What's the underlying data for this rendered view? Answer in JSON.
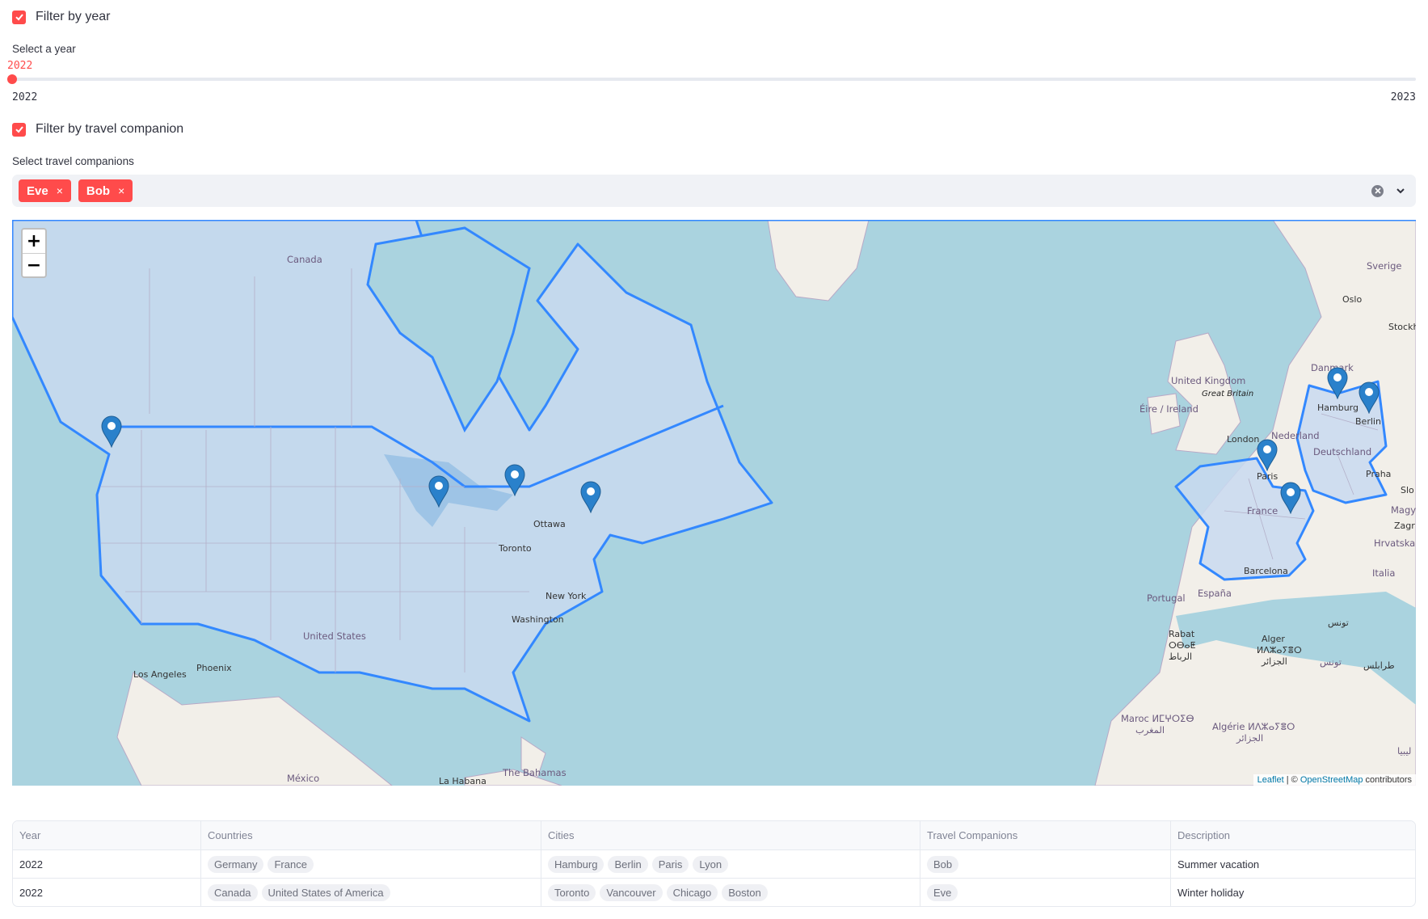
{
  "filters": {
    "year_checkbox": {
      "label": "Filter by year",
      "checked": true
    },
    "year_slider": {
      "label": "Select a year",
      "value": "2022",
      "min": "2022",
      "max": "2023",
      "position_fraction": 0.0
    },
    "companion_checkbox": {
      "label": "Filter by travel companion",
      "checked": true
    },
    "companion_select": {
      "label": "Select travel companions",
      "selected": [
        "Eve",
        "Bob"
      ],
      "remove_glyph": "×"
    }
  },
  "colors": {
    "accent": "#ff4b4b",
    "highlight_fill": "#c9d9f0",
    "highlight_stroke": "#3388ff",
    "water": "#aad3df",
    "land": "#f2efe9",
    "marker": "#2a81cb"
  },
  "map": {
    "zoom_in": "+",
    "zoom_out": "−",
    "attribution": {
      "leaflet": "Leaflet",
      "sep": " | © ",
      "osm": "OpenStreetMap",
      "suffix": " contributors"
    },
    "labels": {
      "canada": "Canada",
      "ottawa": "Ottawa",
      "toronto": "Toronto",
      "new_york": "New York",
      "washington": "Washington",
      "united_states": "United States",
      "phoenix": "Phoenix",
      "los_angeles": "Los Angeles",
      "mexico": "México",
      "la_habana": "La Habana",
      "bahamas": "The Bahamas",
      "sverige": "Sverige",
      "oslo": "Oslo",
      "stockholm": "Stockh",
      "danmark": "Danmark",
      "united_kingdom": "United Kingdom",
      "great_britain": "Great Britain",
      "ireland": "Éire / Ireland",
      "london": "London",
      "nederland": "Nederland",
      "hamburg": "Hamburg",
      "berlin": "Berlin",
      "deutschland": "Deutschland",
      "praha": "Praha",
      "paris": "Paris",
      "france": "France",
      "slo": "Slo",
      "magya": "Magya",
      "zagr": "Zagr",
      "hrvatska": "Hrvatska",
      "barcelona": "Barcelona",
      "italia": "Italia",
      "portugal": "Portugal",
      "espana": "España",
      "rabat": "Rabat",
      "rabat_tf": "ⵔⴱⴰⵟ",
      "rabat_ar": "الرباط",
      "alger": "Alger",
      "alger_tf": "ⵍⴷⵣⴰⵢⴻⵔ",
      "alger_ar": "الجزائر",
      "tunis_ar": "تونس",
      "tunisia_ar": "تونس",
      "tripoli_ar": "طرابلس",
      "maroc": "Maroc ⵍⵎⵖⵔⵉⴱ",
      "maroc_ar": "المغرب",
      "algerie": "Algérie ⵍⴷⵣⴰⵢⴻⵔ",
      "algerie_ar": "الجزائر",
      "libya_ar": "ليبيا"
    },
    "markers": [
      "Vancouver",
      "Chicago",
      "Toronto",
      "Boston",
      "Hamburg",
      "Berlin",
      "Paris",
      "Lyon"
    ]
  },
  "table": {
    "columns": [
      "Year",
      "Countries",
      "Cities",
      "Travel Companions",
      "Description"
    ],
    "rows": [
      {
        "year": "2022",
        "countries": [
          "Germany",
          "France"
        ],
        "cities": [
          "Hamburg",
          "Berlin",
          "Paris",
          "Lyon"
        ],
        "companions": [
          "Bob"
        ],
        "description": "Summer vacation"
      },
      {
        "year": "2022",
        "countries": [
          "Canada",
          "United States of America"
        ],
        "cities": [
          "Toronto",
          "Vancouver",
          "Chicago",
          "Boston"
        ],
        "companions": [
          "Eve"
        ],
        "description": "Winter holiday"
      }
    ]
  }
}
